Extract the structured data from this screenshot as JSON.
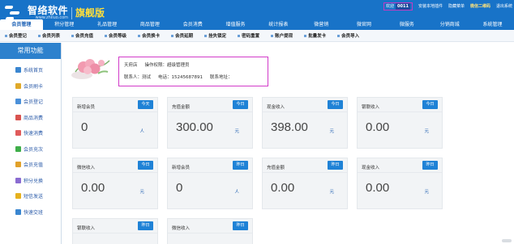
{
  "header": {
    "brand": "智络软件",
    "brand_sub": "www.zhiluo.com",
    "edition": "旗舰版",
    "welcome": "欢迎",
    "user_code": "0011",
    "links": [
      "安装本地插件",
      "隐藏菜单",
      "微信二维码",
      "退出系统"
    ]
  },
  "main_nav": [
    {
      "label": "会员管理",
      "active": true
    },
    {
      "label": "积分管理",
      "active": false
    },
    {
      "label": "礼品管理",
      "active": false
    },
    {
      "label": "商品管理",
      "active": false
    },
    {
      "label": "会员消费",
      "active": false
    },
    {
      "label": "增值服务",
      "active": false
    },
    {
      "label": "统计报表",
      "active": false
    },
    {
      "label": "微营销",
      "active": false
    },
    {
      "label": "微官网",
      "active": false
    },
    {
      "label": "微服务",
      "active": false
    },
    {
      "label": "分销商城",
      "active": false
    },
    {
      "label": "系统管理",
      "active": false
    }
  ],
  "sub_nav": [
    "会员登记",
    "会员列表",
    "会员充值",
    "会员等级",
    "会员换卡",
    "会员延期",
    "挂失锁定",
    "密码重置",
    "账户提现",
    "批量发卡",
    "会员导入"
  ],
  "sidebar": {
    "title": "常用功能",
    "items": [
      {
        "label": "系统首页",
        "icon": "home-icon",
        "color": "#3a86d0"
      },
      {
        "label": "会员刷卡",
        "icon": "card-icon",
        "color": "#e0a92a"
      },
      {
        "label": "会员登记",
        "icon": "user-add-icon",
        "color": "#4a90d9"
      },
      {
        "label": "商品消费",
        "icon": "cart-icon",
        "color": "#d9534f"
      },
      {
        "label": "快速消费",
        "icon": "fast-icon",
        "color": "#e05b5b"
      },
      {
        "label": "会员充次",
        "icon": "recharge-times-icon",
        "color": "#3fae49"
      },
      {
        "label": "会员充值",
        "icon": "recharge-icon",
        "color": "#e1a12a"
      },
      {
        "label": "积分兑换",
        "icon": "exchange-icon",
        "color": "#8a6bd1"
      },
      {
        "label": "短信发送",
        "icon": "sms-icon",
        "color": "#e6b11e"
      },
      {
        "label": "快速交班",
        "icon": "handover-icon",
        "color": "#3a86d0"
      }
    ]
  },
  "info": {
    "store": "天府店",
    "permission": "操作权限：超级管理员",
    "contact": "联系人：测试",
    "phone": "电话：15245687891",
    "address": "联系地址："
  },
  "cards": [
    {
      "title": "新增会员",
      "badge": "今天",
      "value": "0",
      "unit": "人"
    },
    {
      "title": "充值金额",
      "badge": "今日",
      "value": "300.00",
      "unit": "元"
    },
    {
      "title": "现金收入",
      "badge": "今日",
      "value": "398.00",
      "unit": "元"
    },
    {
      "title": "银联收入",
      "badge": "今日",
      "value": "0.00",
      "unit": "元"
    },
    {
      "title": "微信收入",
      "badge": "今日",
      "value": "0.00",
      "unit": "元"
    },
    {
      "title": "新增会员",
      "badge": "昨日",
      "value": "0",
      "unit": "人"
    },
    {
      "title": "充值金额",
      "badge": "昨日",
      "value": "0.00",
      "unit": "元"
    },
    {
      "title": "现金收入",
      "badge": "昨日",
      "value": "0.00",
      "unit": "元"
    },
    {
      "title": "银联收入",
      "badge": "昨日",
      "value": "",
      "unit": ""
    },
    {
      "title": "微信收入",
      "badge": "昨日",
      "value": "",
      "unit": ""
    }
  ],
  "colors": {
    "header_blue": "#1873c8",
    "accent_blue": "#1f82d6",
    "edition_yellow": "#ffde3b",
    "highlight_border": "#d23bc9"
  }
}
